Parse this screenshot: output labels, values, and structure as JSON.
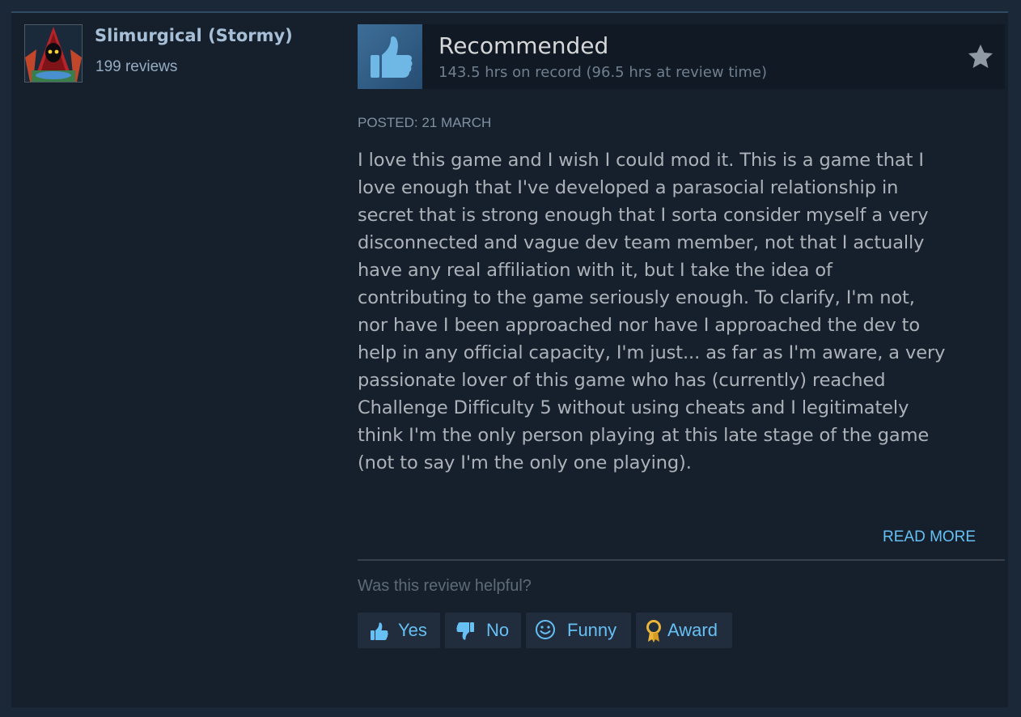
{
  "author": {
    "name": "Slimurgical (Stormy)",
    "review_count": "199 reviews",
    "avatar_icon": "hooded-figure-avatar"
  },
  "header": {
    "verdict": "Recommended",
    "hours": "143.5 hrs on record (96.5 hrs at review time)",
    "verdict_icon": "thumbs-up-icon",
    "award_icon": "star-icon"
  },
  "posted": "POSTED: 21 MARCH",
  "review_lines": [
    "I love this game and I wish I could mod it. This is a game that I",
    "love enough that I've developed a parasocial relationship in",
    "secret that is strong enough that I sorta consider myself a very",
    "disconnected and vague dev team member, not that I actually",
    "have any real affiliation with it, but I take the idea of",
    "contributing to the game seriously enough. To clarify, I'm not,",
    "nor have I been approached nor have I approached the dev to",
    "help in any official capacity, I'm just... as far as I'm aware, a very",
    "passionate lover of this game who has (currently) reached",
    "Challenge Difficulty 5 without using cheats and I legitimately",
    "think I'm the only person playing at this late stage of the game",
    "(not to say I'm the only one playing)."
  ],
  "read_more": "READ MORE",
  "helpful_prompt": "Was this review helpful?",
  "buttons": {
    "yes": "Yes",
    "no": "No",
    "funny": "Funny",
    "award": "Award"
  },
  "colors": {
    "background": "#1b2838",
    "panel": "#16202d",
    "accent_link": "#66c0f4",
    "thumb_box": "#2f5a82"
  }
}
